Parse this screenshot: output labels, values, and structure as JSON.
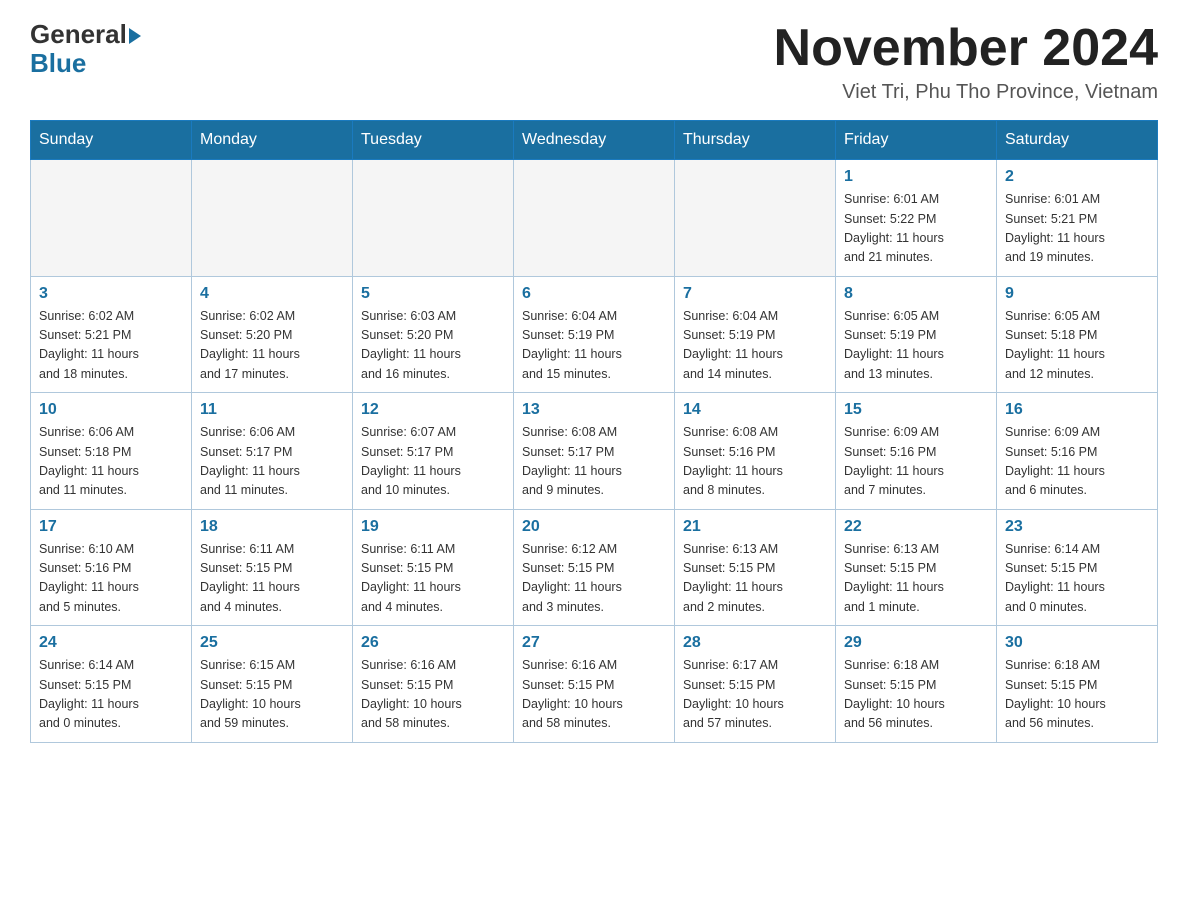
{
  "header": {
    "logo_top": "General",
    "logo_bottom": "Blue",
    "month_title": "November 2024",
    "location": "Viet Tri, Phu Tho Province, Vietnam"
  },
  "days_of_week": [
    "Sunday",
    "Monday",
    "Tuesday",
    "Wednesday",
    "Thursday",
    "Friday",
    "Saturday"
  ],
  "weeks": [
    {
      "days": [
        {
          "num": "",
          "info": ""
        },
        {
          "num": "",
          "info": ""
        },
        {
          "num": "",
          "info": ""
        },
        {
          "num": "",
          "info": ""
        },
        {
          "num": "",
          "info": ""
        },
        {
          "num": "1",
          "info": "Sunrise: 6:01 AM\nSunset: 5:22 PM\nDaylight: 11 hours\nand 21 minutes."
        },
        {
          "num": "2",
          "info": "Sunrise: 6:01 AM\nSunset: 5:21 PM\nDaylight: 11 hours\nand 19 minutes."
        }
      ]
    },
    {
      "days": [
        {
          "num": "3",
          "info": "Sunrise: 6:02 AM\nSunset: 5:21 PM\nDaylight: 11 hours\nand 18 minutes."
        },
        {
          "num": "4",
          "info": "Sunrise: 6:02 AM\nSunset: 5:20 PM\nDaylight: 11 hours\nand 17 minutes."
        },
        {
          "num": "5",
          "info": "Sunrise: 6:03 AM\nSunset: 5:20 PM\nDaylight: 11 hours\nand 16 minutes."
        },
        {
          "num": "6",
          "info": "Sunrise: 6:04 AM\nSunset: 5:19 PM\nDaylight: 11 hours\nand 15 minutes."
        },
        {
          "num": "7",
          "info": "Sunrise: 6:04 AM\nSunset: 5:19 PM\nDaylight: 11 hours\nand 14 minutes."
        },
        {
          "num": "8",
          "info": "Sunrise: 6:05 AM\nSunset: 5:19 PM\nDaylight: 11 hours\nand 13 minutes."
        },
        {
          "num": "9",
          "info": "Sunrise: 6:05 AM\nSunset: 5:18 PM\nDaylight: 11 hours\nand 12 minutes."
        }
      ]
    },
    {
      "days": [
        {
          "num": "10",
          "info": "Sunrise: 6:06 AM\nSunset: 5:18 PM\nDaylight: 11 hours\nand 11 minutes."
        },
        {
          "num": "11",
          "info": "Sunrise: 6:06 AM\nSunset: 5:17 PM\nDaylight: 11 hours\nand 11 minutes."
        },
        {
          "num": "12",
          "info": "Sunrise: 6:07 AM\nSunset: 5:17 PM\nDaylight: 11 hours\nand 10 minutes."
        },
        {
          "num": "13",
          "info": "Sunrise: 6:08 AM\nSunset: 5:17 PM\nDaylight: 11 hours\nand 9 minutes."
        },
        {
          "num": "14",
          "info": "Sunrise: 6:08 AM\nSunset: 5:16 PM\nDaylight: 11 hours\nand 8 minutes."
        },
        {
          "num": "15",
          "info": "Sunrise: 6:09 AM\nSunset: 5:16 PM\nDaylight: 11 hours\nand 7 minutes."
        },
        {
          "num": "16",
          "info": "Sunrise: 6:09 AM\nSunset: 5:16 PM\nDaylight: 11 hours\nand 6 minutes."
        }
      ]
    },
    {
      "days": [
        {
          "num": "17",
          "info": "Sunrise: 6:10 AM\nSunset: 5:16 PM\nDaylight: 11 hours\nand 5 minutes."
        },
        {
          "num": "18",
          "info": "Sunrise: 6:11 AM\nSunset: 5:15 PM\nDaylight: 11 hours\nand 4 minutes."
        },
        {
          "num": "19",
          "info": "Sunrise: 6:11 AM\nSunset: 5:15 PM\nDaylight: 11 hours\nand 4 minutes."
        },
        {
          "num": "20",
          "info": "Sunrise: 6:12 AM\nSunset: 5:15 PM\nDaylight: 11 hours\nand 3 minutes."
        },
        {
          "num": "21",
          "info": "Sunrise: 6:13 AM\nSunset: 5:15 PM\nDaylight: 11 hours\nand 2 minutes."
        },
        {
          "num": "22",
          "info": "Sunrise: 6:13 AM\nSunset: 5:15 PM\nDaylight: 11 hours\nand 1 minute."
        },
        {
          "num": "23",
          "info": "Sunrise: 6:14 AM\nSunset: 5:15 PM\nDaylight: 11 hours\nand 0 minutes."
        }
      ]
    },
    {
      "days": [
        {
          "num": "24",
          "info": "Sunrise: 6:14 AM\nSunset: 5:15 PM\nDaylight: 11 hours\nand 0 minutes."
        },
        {
          "num": "25",
          "info": "Sunrise: 6:15 AM\nSunset: 5:15 PM\nDaylight: 10 hours\nand 59 minutes."
        },
        {
          "num": "26",
          "info": "Sunrise: 6:16 AM\nSunset: 5:15 PM\nDaylight: 10 hours\nand 58 minutes."
        },
        {
          "num": "27",
          "info": "Sunrise: 6:16 AM\nSunset: 5:15 PM\nDaylight: 10 hours\nand 58 minutes."
        },
        {
          "num": "28",
          "info": "Sunrise: 6:17 AM\nSunset: 5:15 PM\nDaylight: 10 hours\nand 57 minutes."
        },
        {
          "num": "29",
          "info": "Sunrise: 6:18 AM\nSunset: 5:15 PM\nDaylight: 10 hours\nand 56 minutes."
        },
        {
          "num": "30",
          "info": "Sunrise: 6:18 AM\nSunset: 5:15 PM\nDaylight: 10 hours\nand 56 minutes."
        }
      ]
    }
  ]
}
